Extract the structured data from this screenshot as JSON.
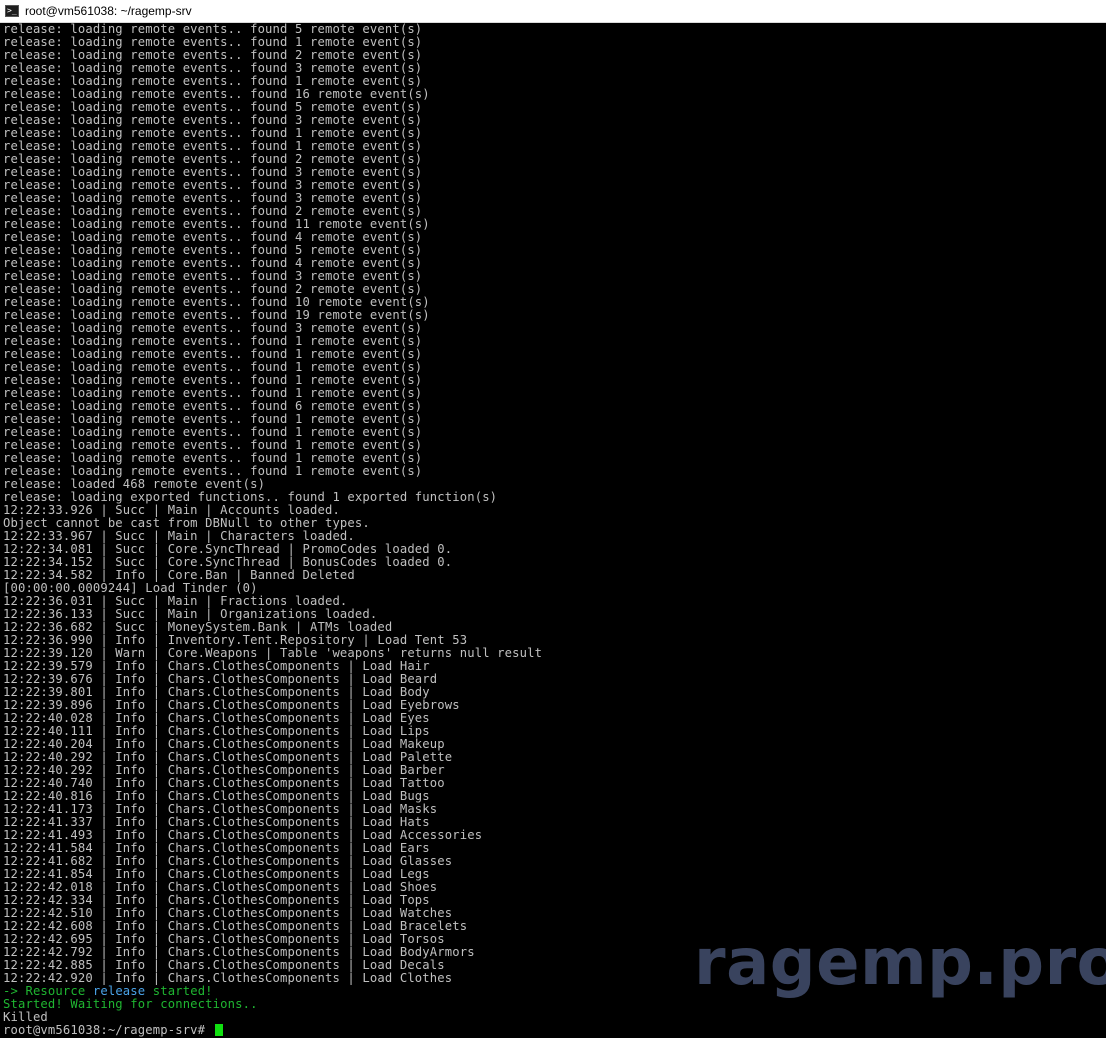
{
  "window": {
    "title": "root@vm561038: ~/ragemp-srv",
    "icon": "terminal-icon"
  },
  "terminal": {
    "lines_top": [
      "release: loading remote events.. found 5 remote event(s)",
      "release: loading remote events.. found 1 remote event(s)",
      "release: loading remote events.. found 2 remote event(s)",
      "release: loading remote events.. found 3 remote event(s)",
      "release: loading remote events.. found 1 remote event(s)",
      "release: loading remote events.. found 16 remote event(s)",
      "release: loading remote events.. found 5 remote event(s)",
      "release: loading remote events.. found 3 remote event(s)",
      "release: loading remote events.. found 1 remote event(s)",
      "release: loading remote events.. found 1 remote event(s)",
      "release: loading remote events.. found 2 remote event(s)",
      "release: loading remote events.. found 3 remote event(s)",
      "release: loading remote events.. found 3 remote event(s)",
      "release: loading remote events.. found 3 remote event(s)",
      "release: loading remote events.. found 2 remote event(s)",
      "release: loading remote events.. found 11 remote event(s)",
      "release: loading remote events.. found 4 remote event(s)",
      "release: loading remote events.. found 5 remote event(s)",
      "release: loading remote events.. found 4 remote event(s)",
      "release: loading remote events.. found 3 remote event(s)",
      "release: loading remote events.. found 2 remote event(s)",
      "release: loading remote events.. found 10 remote event(s)",
      "release: loading remote events.. found 19 remote event(s)",
      "release: loading remote events.. found 3 remote event(s)",
      "release: loading remote events.. found 1 remote event(s)",
      "release: loading remote events.. found 1 remote event(s)",
      "release: loading remote events.. found 1 remote event(s)",
      "release: loading remote events.. found 1 remote event(s)",
      "release: loading remote events.. found 1 remote event(s)",
      "release: loading remote events.. found 6 remote event(s)",
      "release: loading remote events.. found 1 remote event(s)",
      "release: loading remote events.. found 1 remote event(s)",
      "release: loading remote events.. found 1 remote event(s)",
      "release: loading remote events.. found 1 remote event(s)",
      "release: loading remote events.. found 1 remote event(s)",
      "release: loaded 468 remote event(s)",
      "release: loading exported functions.. found 1 exported function(s)",
      "12:22:33.926 | Succ | Main | Accounts loaded.",
      "Object cannot be cast from DBNull to other types.",
      "12:22:33.967 | Succ | Main | Characters loaded.",
      "12:22:34.081 | Succ | Core.SyncThread | PromoCodes loaded 0.",
      "12:22:34.152 | Succ | Core.SyncThread | BonusCodes loaded 0.",
      "12:22:34.582 | Info | Core.Ban | Banned Deleted",
      "[00:00:00.0009244] Load Tinder (0)",
      "12:22:36.031 | Succ | Main | Fractions loaded.",
      "12:22:36.133 | Succ | Main | Organizations loaded.",
      "12:22:36.682 | Succ | MoneySystem.Bank | ATMs loaded",
      "12:22:36.990 | Info | Inventory.Tent.Repository | Load Tent 53",
      "12:22:39.120 | Warn | Core.Weapons | Table 'weapons' returns null result",
      "12:22:39.579 | Info | Chars.ClothesComponents | Load Hair",
      "12:22:39.676 | Info | Chars.ClothesComponents | Load Beard",
      "12:22:39.801 | Info | Chars.ClothesComponents | Load Body",
      "12:22:39.896 | Info | Chars.ClothesComponents | Load Eyebrows",
      "12:22:40.028 | Info | Chars.ClothesComponents | Load Eyes",
      "12:22:40.111 | Info | Chars.ClothesComponents | Load Lips",
      "12:22:40.204 | Info | Chars.ClothesComponents | Load Makeup",
      "12:22:40.292 | Info | Chars.ClothesComponents | Load Palette",
      "12:22:40.292 | Info | Chars.ClothesComponents | Load Barber",
      "12:22:40.740 | Info | Chars.ClothesComponents | Load Tattoo",
      "12:22:40.816 | Info | Chars.ClothesComponents | Load Bugs",
      "12:22:41.173 | Info | Chars.ClothesComponents | Load Masks",
      "12:22:41.337 | Info | Chars.ClothesComponents | Load Hats",
      "12:22:41.493 | Info | Chars.ClothesComponents | Load Accessories",
      "12:22:41.584 | Info | Chars.ClothesComponents | Load Ears",
      "12:22:41.682 | Info | Chars.ClothesComponents | Load Glasses",
      "12:22:41.854 | Info | Chars.ClothesComponents | Load Legs",
      "12:22:42.018 | Info | Chars.ClothesComponents | Load Shoes",
      "12:22:42.334 | Info | Chars.ClothesComponents | Load Tops",
      "12:22:42.510 | Info | Chars.ClothesComponents | Load Watches",
      "12:22:42.608 | Info | Chars.ClothesComponents | Load Bracelets",
      "12:22:42.695 | Info | Chars.ClothesComponents | Load Torsos",
      "12:22:42.792 | Info | Chars.ClothesComponents | Load BodyArmors",
      "12:22:42.885 | Info | Chars.ClothesComponents | Load Decals",
      "12:22:42.920 | Info | Chars.ClothesComponents | Load Clothes"
    ],
    "resource_line": {
      "prefix": "-> Resource ",
      "name": "release",
      "suffix": " started!"
    },
    "started_line": "Started! Waiting for connections..",
    "killed_line": "Killed",
    "prompt": "root@vm561038:~/ragemp-srv# "
  },
  "watermark": "ragemp.pro",
  "colors": {
    "background": "#000000",
    "text": "#c0c0c0",
    "green": "#1fb531",
    "blue": "#4aa3e8",
    "cursor": "#10e010",
    "watermark": "#39435e"
  }
}
